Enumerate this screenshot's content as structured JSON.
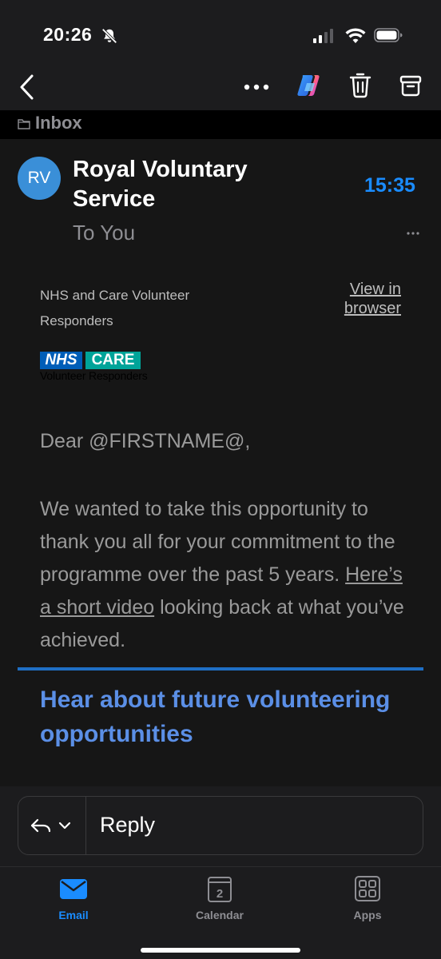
{
  "status_bar": {
    "time": "20:26",
    "icons": [
      "bell-slash-icon",
      "signal-icon",
      "wifi-icon",
      "battery-icon"
    ]
  },
  "toolbar": {
    "icons": [
      "back-icon",
      "more-icon",
      "copilot-icon",
      "trash-icon",
      "archive-icon"
    ]
  },
  "folder": {
    "label": "Inbox"
  },
  "message": {
    "avatar_initials": "RV",
    "sender": "Royal Voluntary Service",
    "recipients": "To You",
    "time": "15:35",
    "accent_color": "#1a8cff",
    "email": {
      "sender_line": "NHS and Care Volunteer Responders",
      "view_in_browser": "View in browser",
      "logo": {
        "nhs": "NHS",
        "care": "CARE",
        "subtitle": "Volunteer Responders",
        "nhs_color": "#005eb8",
        "care_color": "#00a499"
      },
      "greeting": "Dear @FIRSTNAME@,",
      "paragraph_before_link": "We wanted to take this opportunity to thank you all for your commitment to the programme over the past 5 years. ",
      "paragraph_link": "Here’s a short video",
      "paragraph_after_link": " looking back at what you’ve achieved.",
      "section_heading": "Hear about future volunteering opportunities",
      "heading_color": "#5b8fe6"
    }
  },
  "reply_bar": {
    "label": "Reply"
  },
  "tab_bar": {
    "tabs": [
      {
        "label": "Email",
        "icon": "mail-icon",
        "active": true
      },
      {
        "label": "Calendar",
        "icon": "calendar-icon",
        "badge": "2",
        "active": false
      },
      {
        "label": "Apps",
        "icon": "apps-icon",
        "active": false
      }
    ]
  }
}
